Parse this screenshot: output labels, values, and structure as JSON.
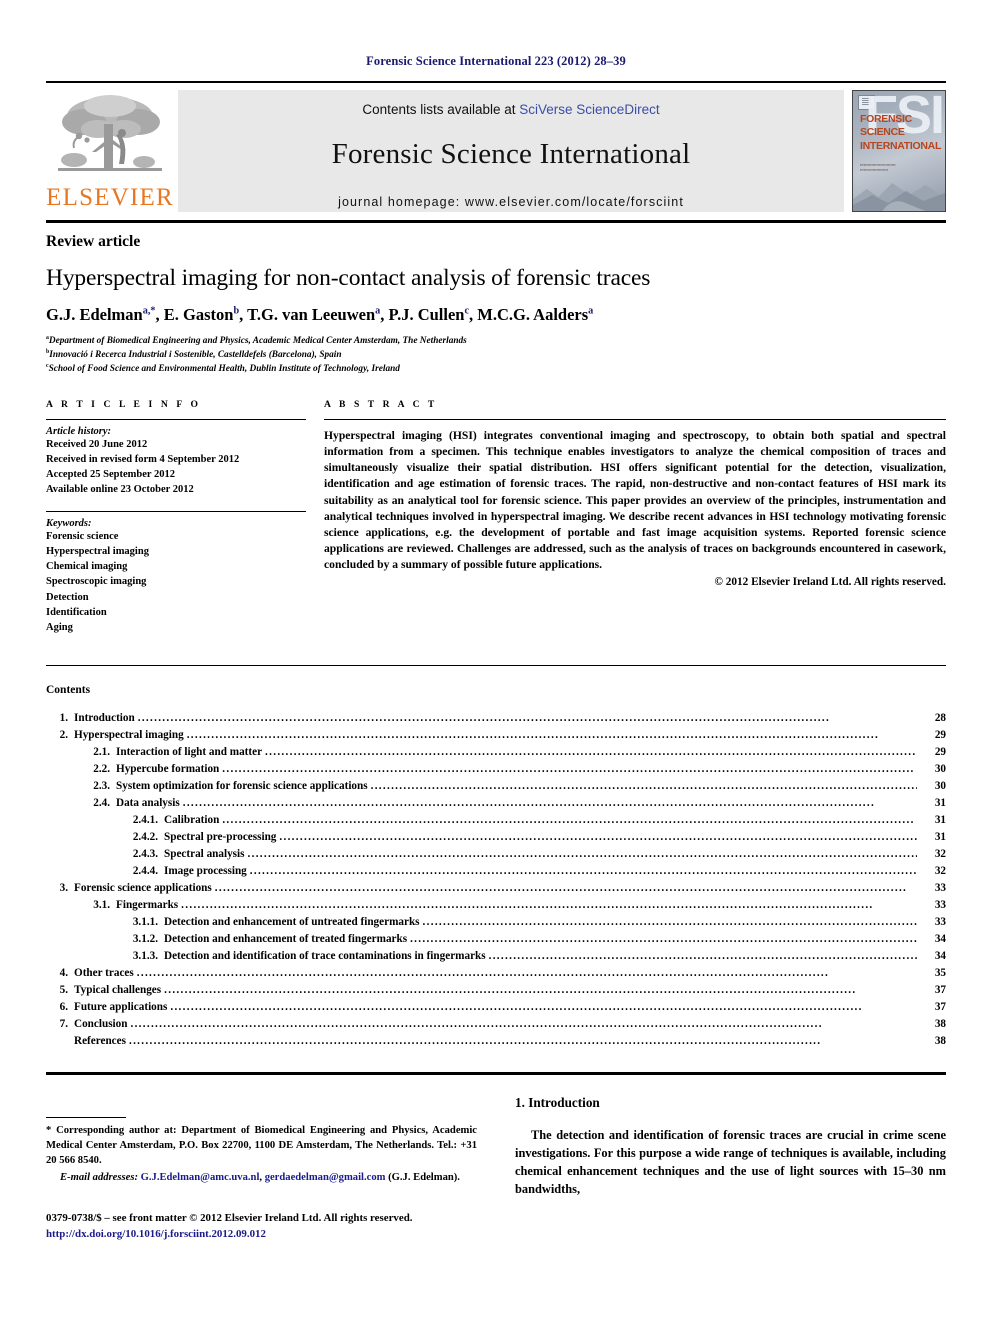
{
  "running_head": "Forensic Science International 223 (2012) 28–39",
  "banner": {
    "publisher_logo_text": "ELSEVIER",
    "contents_prefix": "Contents lists available at ",
    "contents_link": "SciVerse ScienceDirect",
    "journal_title": "Forensic Science International",
    "homepage": "journal homepage: www.elsevier.com/locate/forsciint",
    "cover": {
      "acronym": "FSI",
      "title_lines": "FORENSIC\nSCIENCE\nINTERNATIONAL"
    }
  },
  "article": {
    "type_label": "Review article",
    "title": "Hyperspectral imaging for non-contact analysis of forensic traces",
    "authors": "G.J. Edelman a,*, E. Gaston b, T.G. van Leeuwen a, P.J. Cullen c, M.C.G. Aalders a",
    "affiliations": [
      {
        "marker": "a",
        "text": "Department of Biomedical Engineering and Physics, Academic Medical Center Amsterdam, The Netherlands"
      },
      {
        "marker": "b",
        "text": "Innovació i Recerca Industrial i Sostenible, Castelldefels (Barcelona), Spain"
      },
      {
        "marker": "c",
        "text": "School of Food Science and Environmental Health, Dublin Institute of Technology, Ireland"
      }
    ]
  },
  "article_info": {
    "heading": "A R T I C L E   I N F O",
    "history_title": "Article history:",
    "history": [
      "Received 20 June 2012",
      "Received in revised form 4 September 2012",
      "Accepted 25 September 2012",
      "Available online 23 October 2012"
    ],
    "keywords_title": "Keywords:",
    "keywords": [
      "Forensic science",
      "Hyperspectral imaging",
      "Chemical imaging",
      "Spectroscopic imaging",
      "Detection",
      "Identification",
      "Aging"
    ]
  },
  "abstract": {
    "heading": "A B S T R A C T",
    "text": "Hyperspectral imaging (HSI) integrates conventional imaging and spectroscopy, to obtain both spatial and spectral information from a specimen. This technique enables investigators to analyze the chemical composition of traces and simultaneously visualize their spatial distribution. HSI offers significant potential for the detection, visualization, identification and age estimation of forensic traces. The rapid, non-destructive and non-contact features of HSI mark its suitability as an analytical tool for forensic science. This paper provides an overview of the principles, instrumentation and analytical techniques involved in hyperspectral imaging. We describe recent advances in HSI technology motivating forensic science applications, e.g. the development of portable and fast image acquisition systems. Reported forensic science applications are reviewed. Challenges are addressed, such as the analysis of traces on backgrounds encountered in casework, concluded by a summary of possible future applications.",
    "copyright": "© 2012 Elsevier Ireland Ltd. All rights reserved."
  },
  "contents": {
    "heading": "Contents",
    "entries": [
      {
        "level": 1,
        "num": "1.",
        "label": "Introduction",
        "page": "28"
      },
      {
        "level": 1,
        "num": "2.",
        "label": "Hyperspectral imaging",
        "page": "29"
      },
      {
        "level": 2,
        "num": "2.1.",
        "label": "Interaction of light and matter",
        "page": "29"
      },
      {
        "level": 2,
        "num": "2.2.",
        "label": "Hypercube formation",
        "page": "30"
      },
      {
        "level": 2,
        "num": "2.3.",
        "label": "System optimization for forensic science applications",
        "page": "30"
      },
      {
        "level": 2,
        "num": "2.4.",
        "label": "Data analysis",
        "page": "31"
      },
      {
        "level": 3,
        "num": "2.4.1.",
        "label": "Calibration",
        "page": "31"
      },
      {
        "level": 3,
        "num": "2.4.2.",
        "label": "Spectral pre-processing",
        "page": "31"
      },
      {
        "level": 3,
        "num": "2.4.3.",
        "label": "Spectral analysis",
        "page": "32"
      },
      {
        "level": 3,
        "num": "2.4.4.",
        "label": "Image processing",
        "page": "32"
      },
      {
        "level": 1,
        "num": "3.",
        "label": "Forensic science applications",
        "page": "33"
      },
      {
        "level": 2,
        "num": "3.1.",
        "label": "Fingermarks",
        "page": "33"
      },
      {
        "level": 3,
        "num": "3.1.1.",
        "label": "Detection and enhancement of untreated fingermarks",
        "page": "33"
      },
      {
        "level": 3,
        "num": "3.1.2.",
        "label": "Detection and enhancement of treated fingermarks",
        "page": "34"
      },
      {
        "level": 3,
        "num": "3.1.3.",
        "label": "Detection and identification of trace contaminations in fingermarks",
        "page": "34"
      },
      {
        "level": 1,
        "num": "4.",
        "label": "Other traces",
        "page": "35"
      },
      {
        "level": 1,
        "num": "5.",
        "label": "Typical challenges",
        "page": "37"
      },
      {
        "level": 1,
        "num": "6.",
        "label": "Future applications",
        "page": "37"
      },
      {
        "level": 1,
        "num": "7.",
        "label": "Conclusion",
        "page": "38"
      },
      {
        "level": 1,
        "num": "",
        "label": "References",
        "page": "38"
      }
    ]
  },
  "footnote": {
    "corresponding": "* Corresponding author at: Department of Biomedical Engineering and Physics, Academic Medical Center Amsterdam, P.O. Box 22700, 1100 DE Amsterdam, The Netherlands. Tel.: +31 20 566 8540.",
    "email_label": "E-mail addresses:",
    "email_1": "G.J.Edelman@amc.uva.nl",
    "email_sep": ", ",
    "email_2": "gerdaedelman@gmail.com",
    "email_owner": "(G.J. Edelman)."
  },
  "frontmatter": {
    "line": "0379-0738/$ – see front matter © 2012 Elsevier Ireland Ltd. All rights reserved.",
    "doi": "http://dx.doi.org/10.1016/j.forsciint.2012.09.012"
  },
  "introduction": {
    "heading": "1. Introduction",
    "paragraph": "The detection and identification of forensic traces are crucial in crime scene investigations. For this purpose a wide range of techniques is available, including chemical enhancement techniques and the use of light sources with 15–30 nm bandwidths,"
  },
  "colors": {
    "running_head": "#1a1a6e",
    "link": "#3b4ea8",
    "elsevier_orange": "#E87722",
    "doi_blue": "#1a1a8c"
  }
}
